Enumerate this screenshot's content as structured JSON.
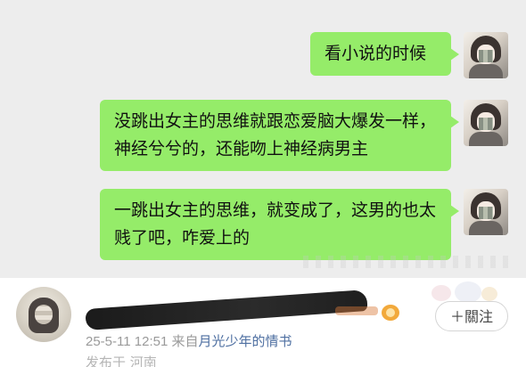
{
  "chat": {
    "messages": [
      {
        "text": "看小说的时候"
      },
      {
        "text": "没跳出女主的思维就跟恋爱脑大爆发一样，神经兮兮的，还能吻上神经病男主"
      },
      {
        "text": "一跳出女主的思维，就变成了，这男的也太贱了吧，咋爱上的"
      }
    ]
  },
  "post": {
    "timestamp": "25-5-11 12:51",
    "source_prefix": "来自",
    "source_name": "月光少年的情书",
    "cut_text": "发布于 河南",
    "follow_label": "＋關注"
  },
  "colors": {
    "bubble": "#95ec69",
    "chat_bg": "#ededed",
    "source_link": "#4e6fa1"
  }
}
